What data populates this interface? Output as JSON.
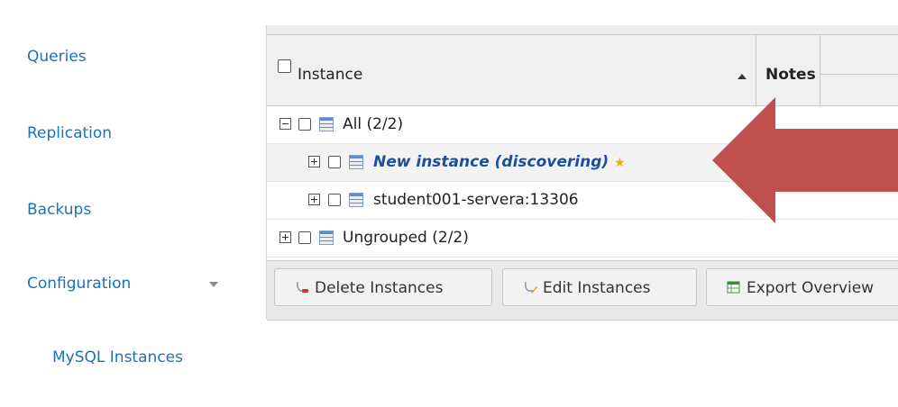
{
  "sidebar": {
    "items": [
      {
        "label": "Queries"
      },
      {
        "label": "Replication"
      },
      {
        "label": "Backups"
      },
      {
        "label": "Configuration"
      }
    ],
    "sub_items": [
      {
        "label": "MySQL Instances"
      }
    ]
  },
  "grid": {
    "header": {
      "instance_label": "Instance",
      "notes_label": "Notes"
    },
    "rows": [
      {
        "label": "All (2/2)",
        "expander": "minus",
        "level": 0
      },
      {
        "label": "New instance (discovering)",
        "expander": "plus",
        "level": 1,
        "status": "discovering",
        "favorite": true
      },
      {
        "label": "student001-servera:13306",
        "expander": "plus",
        "level": 1
      },
      {
        "label": "Ungrouped (2/2)",
        "expander": "plus",
        "level": 0
      }
    ]
  },
  "toolbar": {
    "delete_label": "Delete Instances",
    "edit_label": "Edit Instances",
    "export_label": "Export Overview"
  },
  "colors": {
    "link": "#1a73b8",
    "discover_text": "#1c4f9c",
    "arrow": "#c0504d",
    "star": "#e6b400"
  },
  "icons": {
    "server": "server-icon",
    "star": "star-icon",
    "delete": "delete-instance-icon",
    "edit": "edit-instance-icon",
    "export": "spreadsheet-icon"
  }
}
